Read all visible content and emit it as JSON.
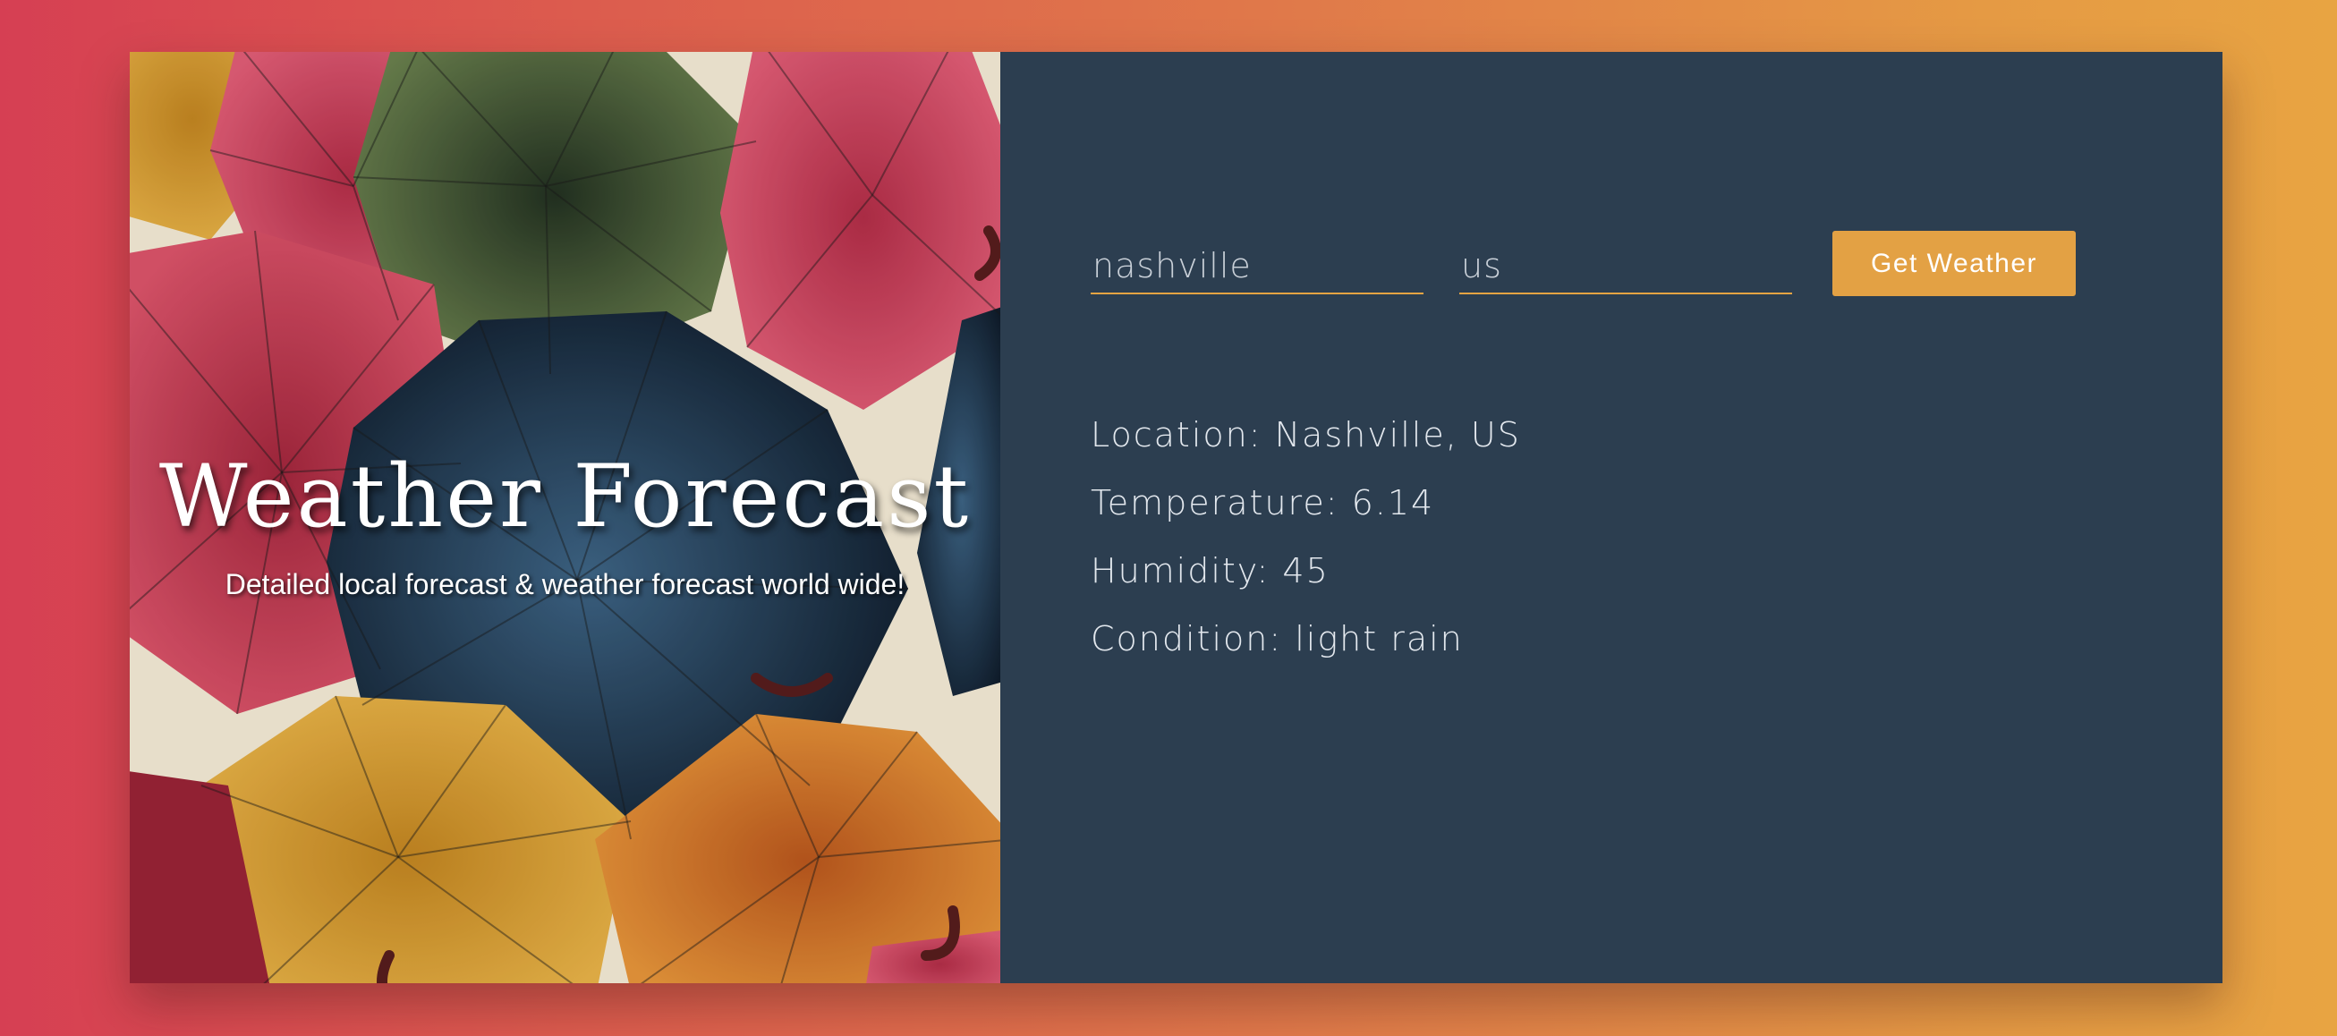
{
  "hero": {
    "title": "Weather Forecast",
    "subtitle": "Detailed local forecast & weather forecast world wide!"
  },
  "form": {
    "city_value": "nashville",
    "country_value": "us",
    "submit_label": "Get Weather"
  },
  "results": {
    "location": "Location: Nashville, US",
    "temperature": "Temperature: 6.14",
    "humidity": "Humidity: 45",
    "condition": "Condition: light rain"
  },
  "colors": {
    "accent": "#e3a144",
    "panel": "#2c3e50",
    "gradient_start": "#d63f53",
    "gradient_end": "#e8a442"
  }
}
